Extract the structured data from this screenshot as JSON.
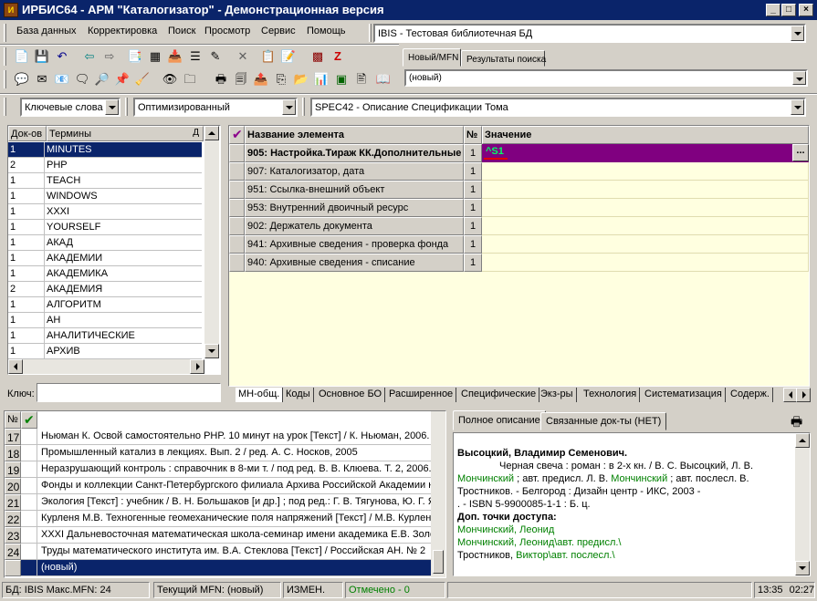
{
  "window": {
    "title": "ИРБИС64 - АРМ \"Каталогизатор\" - Демонстрационная версия",
    "min_symbol": "_",
    "max_symbol": "□",
    "close_symbol": "×"
  },
  "menu": [
    "База данных",
    "Корректировка",
    "Поиск",
    "Просмотр",
    "Сервис",
    "Помощь"
  ],
  "database_combo": "IBIS - Тестовая библиотечная БД",
  "top_tabs": [
    "Новый/MFN",
    "Результаты поиска"
  ],
  "mfn_combo": "(новый)",
  "search_bar": {
    "dictionary_mode": "Ключевые слова",
    "scenario": "Оптимизированный",
    "worksheet": "SPEC42 - Описание Спецификации Тома"
  },
  "terms": {
    "col_count": "Док-ов",
    "col_term": "Термины",
    "pin_symbol": "Д",
    "rows": [
      {
        "count": "1",
        "term": "MINUTES"
      },
      {
        "count": "2",
        "term": "PHP"
      },
      {
        "count": "1",
        "term": "TEACH"
      },
      {
        "count": "1",
        "term": "WINDOWS"
      },
      {
        "count": "1",
        "term": "XXXI"
      },
      {
        "count": "1",
        "term": "YOURSELF"
      },
      {
        "count": "1",
        "term": "АКАД"
      },
      {
        "count": "1",
        "term": "АКАДЕМИИ"
      },
      {
        "count": "1",
        "term": "АКАДЕМИКА"
      },
      {
        "count": "2",
        "term": "АКАДЕМИЯ"
      },
      {
        "count": "1",
        "term": "АЛГОРИТМ"
      },
      {
        "count": "1",
        "term": "АН"
      },
      {
        "count": "1",
        "term": "АНАЛИТИЧЕСКИЕ"
      },
      {
        "count": "1",
        "term": "АРХИВ"
      }
    ],
    "key_label": "Ключ:",
    "key_value": ""
  },
  "elements": {
    "col_name": "Название элемента",
    "col_num": "№",
    "col_value": "Значение",
    "ellipsis": "...",
    "rows": [
      {
        "name": "905: Настройка.Тираж КК.Дополнительные",
        "num": "1",
        "value": "^S1"
      },
      {
        "name": "907: Каталогизатор, дата",
        "num": "1",
        "value": ""
      },
      {
        "name": "951: Ссылка-внешний объект",
        "num": "1",
        "value": ""
      },
      {
        "name": "953: Внутренний двоичный ресурс",
        "num": "1",
        "value": ""
      },
      {
        "name": "902: Держатель документа",
        "num": "1",
        "value": ""
      },
      {
        "name": "941: Архивные сведения - проверка фонда",
        "num": "1",
        "value": ""
      },
      {
        "name": "940: Архивные сведения - списание",
        "num": "1",
        "value": ""
      }
    ]
  },
  "worksheet_tabs": [
    "МН-общ.",
    "Коды",
    "Основное БО",
    "Расширенное",
    "Специфические",
    "Экз-ры",
    "Технология",
    "Систематизация",
    "Содерж."
  ],
  "records": {
    "col_num": "№",
    "rows": [
      {
        "n": "17",
        "text": "Ньюман К. Освой самостоятельно PHP. 10 минут на урок [Текст] / К. Ньюман, 2006."
      },
      {
        "n": "18",
        "text": "Промышленный катализ в лекциях. Вып. 2 / ред. А. С. Носков, 2005"
      },
      {
        "n": "19",
        "text": "Неразрушающий контроль : справочник в 8-ми т. / под ред. В. В. Клюева. Т. 2, 2006."
      },
      {
        "n": "20",
        "text": "Фонды и коллекции Санкт-Петербургского филиала Архива Российской Академии н"
      },
      {
        "n": "21",
        "text": "Экология [Текст] : учебник / В. Н. Большаков [и др.] ; под ред.: Г. В. Тягунова, Ю. Г. Я"
      },
      {
        "n": "22",
        "text": "Курленя М.В. Техногенные геомеханические поля напряжений [Текст] / М.В. Курлен"
      },
      {
        "n": "23",
        "text": "XXXI Дальневосточная математическая школа-семинар имени академика Е.В. Золо"
      },
      {
        "n": "24",
        "text": "Труды математического института им. В.А. Стеклова [Текст] / Российская АН. № 2"
      },
      {
        "n": "",
        "text": "(новый)"
      }
    ]
  },
  "desc_tabs": [
    "Полное описание",
    "Связанные док-ты (НЕТ)"
  ],
  "description": {
    "author": "Высоцкий, Владимир Семенович.",
    "line1": "Черная свеча : роман : в 2-х кн. / В. С. Высоцкий, Л. В.",
    "line2_g": "Мончинский",
    "line2_a": "; авт. предисл. Л. В. ",
    "line2_g2": "Мончинский",
    "line2_b": "; авт. послесл. В.",
    "line3": "Тростников. - Белгород : Дизайн центр - ИКС, 2003 -",
    "line4": ". - ISBN 5-9900085-1-1 : Б. ц.",
    "access_heading": "Доп. точки доступа:",
    "access1": "Мончинский, Леонид",
    "access2": "Мончинский, Леонид\\авт. предисл.\\",
    "access3_a": "Тростников, ",
    "access3_b": "Виктор\\авт. послесл.\\"
  },
  "status": {
    "db": "БД: IBIS Макс.MFN: 24",
    "current": "Текущий MFN: (новый)",
    "changed": "ИЗМЕН.",
    "marked": "Отмечено - 0",
    "time1": "13:35",
    "time2": "02:27"
  },
  "colors": {
    "title_bg": "#0a246a",
    "selection": "#0a246a",
    "element_selected": "#800080",
    "value_bg": "#ffffe0",
    "link_green": "#008000",
    "check_green": "#008000",
    "marked_green": "#008000"
  }
}
